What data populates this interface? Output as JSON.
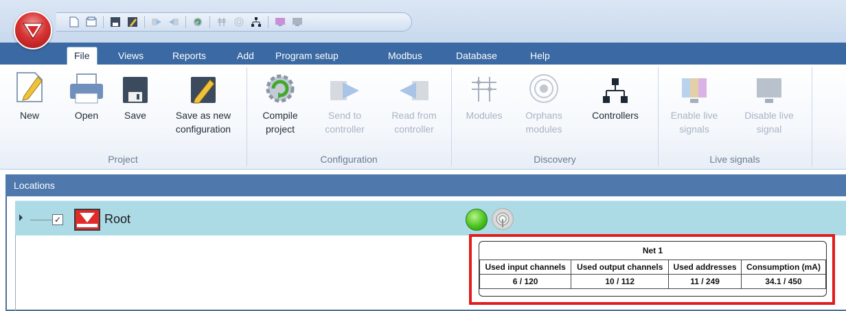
{
  "quick_access": {
    "icons": [
      "new-file-icon",
      "open-icon",
      "save-icon",
      "save-as-icon",
      "send-icon",
      "read-icon",
      "compile-icon",
      "modules-icon",
      "orphans-icon",
      "controllers-icon",
      "enable-live-icon",
      "disable-live-icon"
    ]
  },
  "tabs": [
    {
      "label": "File",
      "active": true
    },
    {
      "label": "Views"
    },
    {
      "label": "Reports"
    },
    {
      "label": "Add"
    },
    {
      "label": "Program setup"
    },
    {
      "label": "Modbus"
    },
    {
      "label": "Database"
    },
    {
      "label": "Help"
    }
  ],
  "ribbon": {
    "buttons": [
      {
        "line1": "New",
        "line2": "",
        "enabled": true
      },
      {
        "line1": "Open",
        "line2": "",
        "enabled": true
      },
      {
        "line1": "Save",
        "line2": "",
        "enabled": true
      },
      {
        "line1": "Save as new",
        "line2": "configuration",
        "enabled": true
      },
      {
        "line1": "Compile",
        "line2": "project",
        "enabled": true
      },
      {
        "line1": "Send to",
        "line2": "controller",
        "enabled": false
      },
      {
        "line1": "Read from",
        "line2": "controller",
        "enabled": false
      },
      {
        "line1": "Modules",
        "line2": "",
        "enabled": false
      },
      {
        "line1": "Orphans",
        "line2": "modules",
        "enabled": false
      },
      {
        "line1": "Controllers",
        "line2": "",
        "enabled": true
      },
      {
        "line1": "Enable live",
        "line2": "signals",
        "enabled": false
      },
      {
        "line1": "Disable live",
        "line2": "signal",
        "enabled": false
      }
    ],
    "groups": [
      "Project",
      "Configuration",
      "Discovery",
      "Live signals"
    ]
  },
  "locations": {
    "header": "Locations",
    "root": {
      "label": "Root",
      "checked": "✓",
      "status_color": "#49c31f"
    }
  },
  "net_tooltip": {
    "title": "Net 1",
    "columns": [
      "Used input channels",
      "Used output channels",
      "Used addresses",
      "Consumption (mA)"
    ],
    "values": [
      "6 / 120",
      "10 / 112",
      "11 / 249",
      "34.1 / 450"
    ]
  },
  "colors": {
    "accent": "#3a69a3",
    "highlight": "#e11c1c",
    "row": "#acdbe5"
  }
}
